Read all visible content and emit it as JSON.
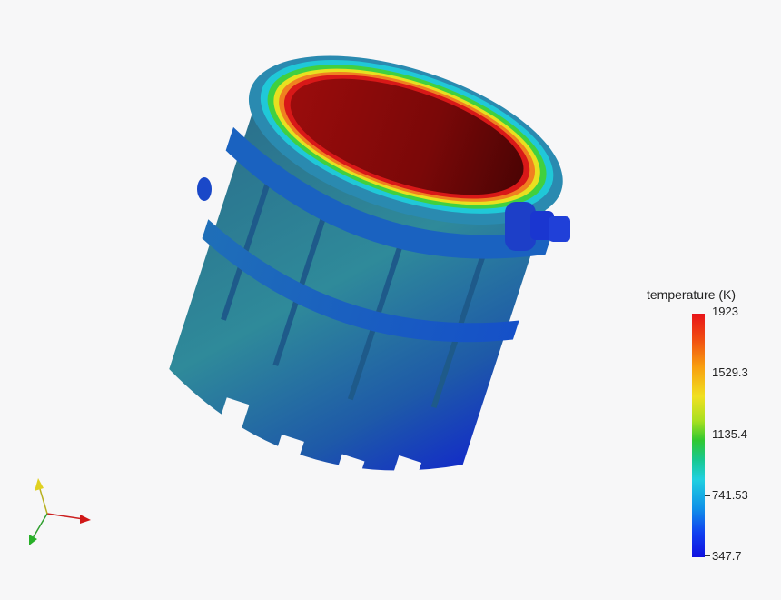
{
  "legend": {
    "title": "temperature (K)",
    "ticks": [
      "1923",
      "1529.3",
      "1135.4",
      "741.53",
      "347.7"
    ]
  },
  "colors": {
    "background": "#f7f7f8",
    "hot": "#8a0a0a",
    "body": "#2e7f96",
    "cold": "#1020d8"
  }
}
